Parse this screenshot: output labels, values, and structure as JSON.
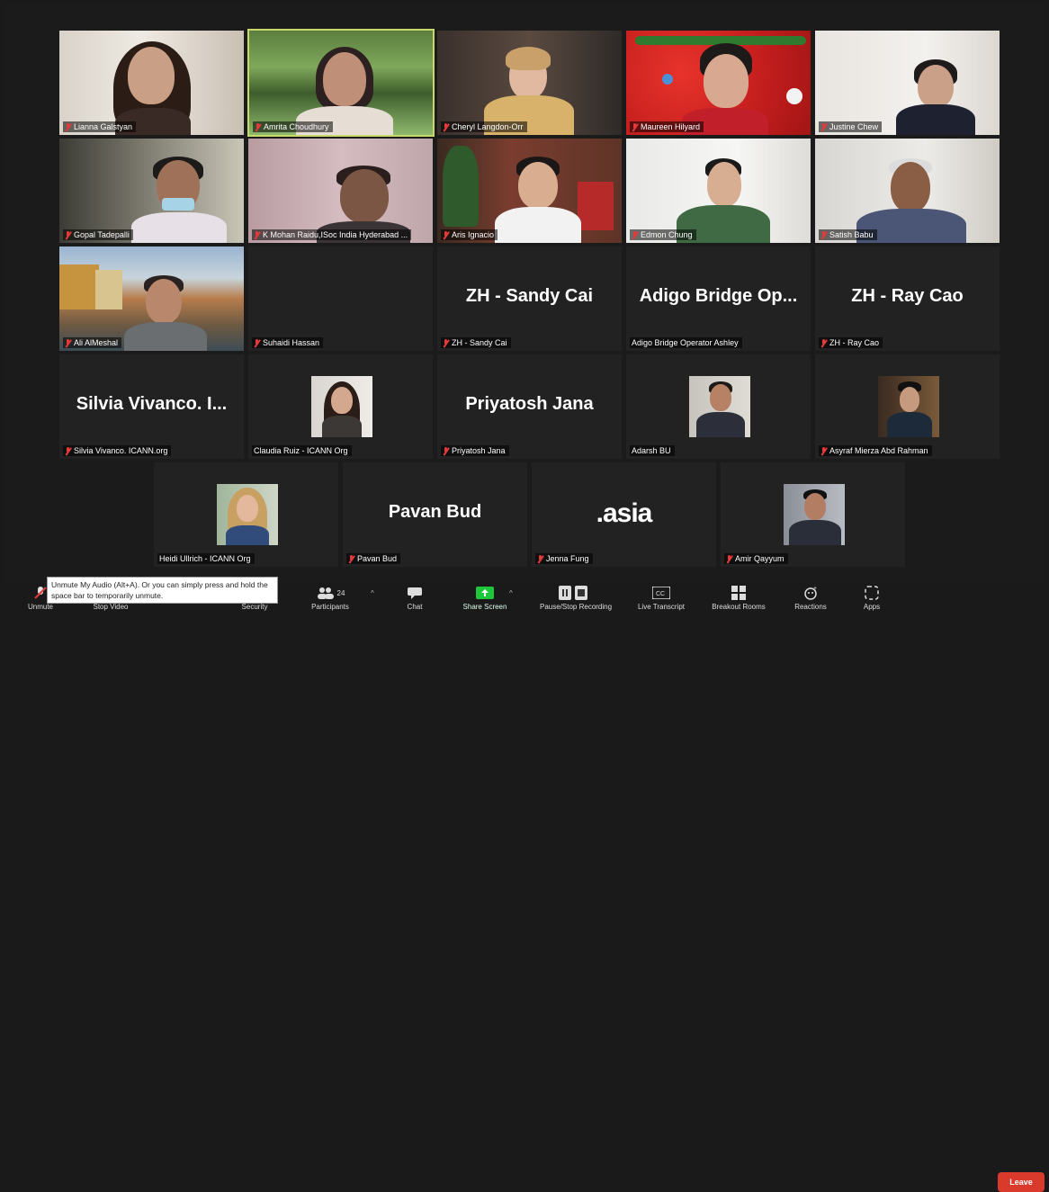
{
  "participants_grid": {
    "row1": [
      {
        "name": "Lianna Galstyan"
      },
      {
        "name": "Amrita Choudhury"
      },
      {
        "name": "Cheryl Langdon-Orr"
      },
      {
        "name": "Maureen Hilyard"
      },
      {
        "name": "Justine Chew"
      }
    ],
    "row2": [
      {
        "name": "Gopal Tadepalli"
      },
      {
        "name": "K Mohan Raidu,ISoc India Hyderabad ..."
      },
      {
        "name": "Aris Ignacio"
      },
      {
        "name": "Edmon Chung"
      },
      {
        "name": "Satish Babu"
      }
    ],
    "row3": [
      {
        "name": "Ali AlMeshal"
      },
      {
        "name": "Suhaidi Hassan"
      },
      {
        "name": "ZH - Sandy Cai",
        "display": "ZH - Sandy Cai"
      },
      {
        "name": "Adigo Bridge Operator Ashley",
        "display": "Adigo Bridge Op..."
      },
      {
        "name": "ZH - Ray Cao",
        "display": "ZH - Ray Cao"
      }
    ],
    "row4": [
      {
        "name": "Silvia Vivanco. ICANN.org",
        "display": "Silvia Vivanco. I..."
      },
      {
        "name": "Claudia Ruiz - ICANN Org"
      },
      {
        "name": "Priyatosh Jana",
        "display": "Priyatosh Jana"
      },
      {
        "name": "Adarsh BU"
      },
      {
        "name": "Asyraf Mierza Abd Rahman"
      }
    ],
    "row5": [
      {
        "name": "Heidi Ullrich - ICANN Org"
      },
      {
        "name": "Pavan Bud",
        "display": "Pavan Bud"
      },
      {
        "name": "Jenna Fung",
        "logo": ".asia"
      },
      {
        "name": "Amir Qayyum"
      }
    ]
  },
  "toolbar": {
    "unmute": "Unmute",
    "stop_video": "Stop Video",
    "security": "Security",
    "participants": "Participants",
    "participants_count": "24",
    "chat": "Chat",
    "share_screen": "Share Screen",
    "recording": "Pause/Stop Recording",
    "transcript": "Live Transcript",
    "breakout": "Breakout Rooms",
    "reactions": "Reactions",
    "apps": "Apps",
    "leave": "Leave"
  },
  "tooltip": {
    "text": "Unmute My Audio (Alt+A). Or you can simply press and hold the space bar to temporarily unmute."
  },
  "colors": {
    "leave": "#d93a2b",
    "share_screen": "#1ec63c",
    "active_speaker_border": "#c9d86a",
    "muted_icon": "#e23b3b"
  }
}
